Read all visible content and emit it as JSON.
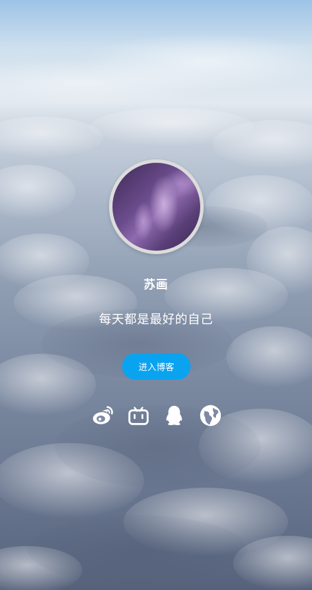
{
  "profile": {
    "name": "苏画",
    "motto": "每天都是最好的自己"
  },
  "actions": {
    "enter_blog_label": "进入博客"
  },
  "social_links": [
    {
      "icon": "weibo-icon"
    },
    {
      "icon": "bilibili-icon"
    },
    {
      "icon": "qq-icon"
    },
    {
      "icon": "globe-icon"
    }
  ],
  "colors": {
    "button": "#0aa3f0",
    "text": "#ffffff"
  }
}
